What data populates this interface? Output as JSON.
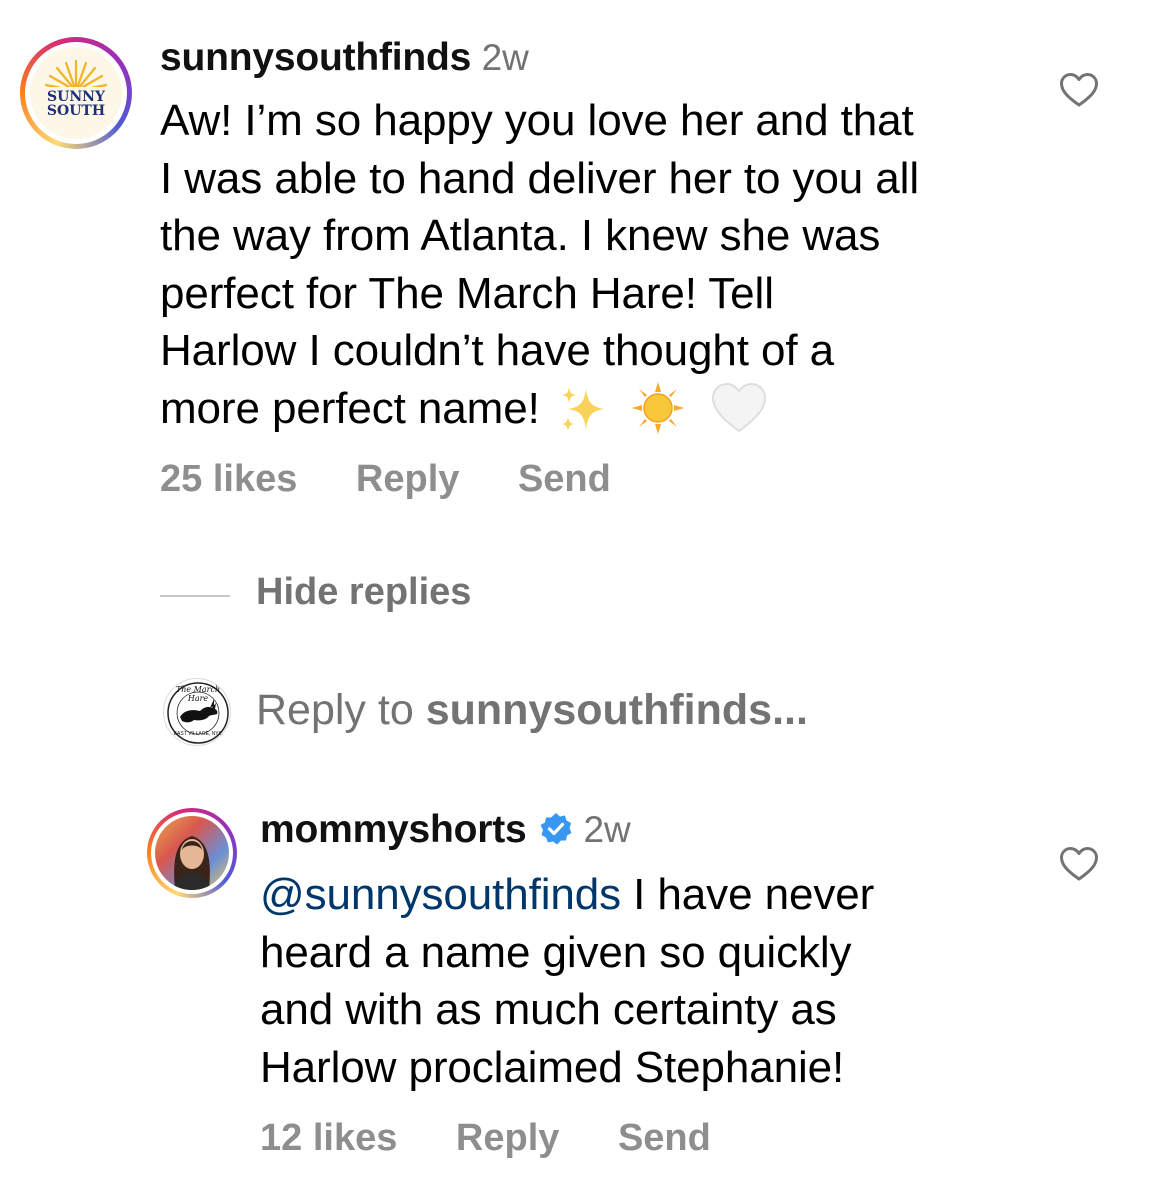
{
  "comment": {
    "avatar_text_line1": "SUNNY",
    "avatar_text_line2": "SOUTH",
    "username": "sunnysouthfinds",
    "time": "2w",
    "text_lines": [
      "Aw! I’m so happy you love her and that",
      "I was able to hand deliver her to you all",
      "the way from Atlanta. I knew she was",
      "perfect for The March Hare! Tell",
      "Harlow I couldn’t have thought of a",
      "more perfect name!"
    ],
    "emojis": [
      "sparkles",
      "sun",
      "white-heart"
    ],
    "likes": "25 likes",
    "reply_label": "Reply",
    "send_label": "Send"
  },
  "replies_toggle": {
    "label": "Hide replies"
  },
  "reply_prompt": {
    "prefix": "Reply to ",
    "username": "sunnysouthfinds...",
    "avatar_text_top": "The March Hare",
    "avatar_text_bottom": "EAST VILLAGE, NYC"
  },
  "reply": {
    "username": "mommyshorts",
    "verified": true,
    "time": "2w",
    "mention": "@sunnysouthfinds",
    "text_first": " I have never",
    "text_lines": [
      "heard a name given so quickly",
      "and with as much certainty as",
      "Harlow proclaimed Stephanie!"
    ],
    "likes": "12 likes",
    "reply_label": "Reply",
    "send_label": "Send"
  },
  "colors": {
    "verified_blue": "#3897f0",
    "mention": "#00376b",
    "muted": "#8e8e8e",
    "sun_yellow": "#f6b51e",
    "sunny_south_navy": "#1f2f7a"
  }
}
